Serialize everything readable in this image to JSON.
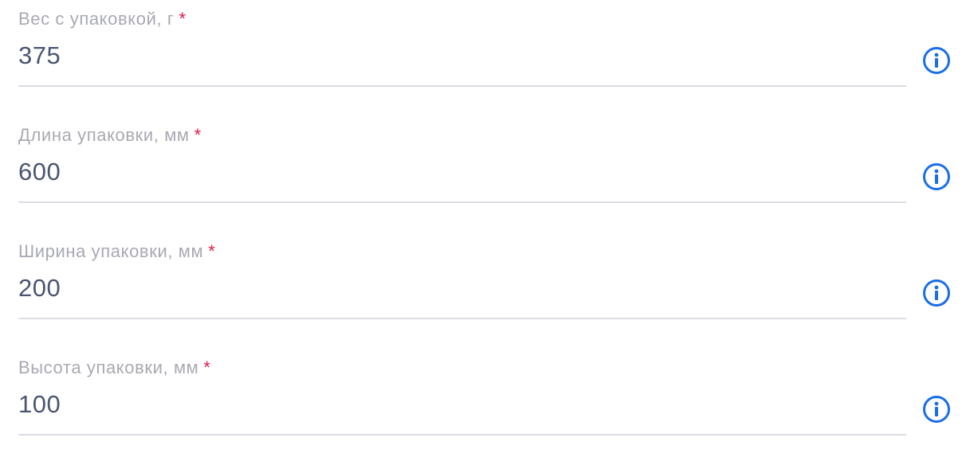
{
  "fields": [
    {
      "label": "Вес с упаковкой, г",
      "required_mark": "*",
      "value": "375",
      "icon": "info-icon"
    },
    {
      "label": "Длина упаковки, мм",
      "required_mark": "*",
      "value": "600",
      "icon": "info-icon"
    },
    {
      "label": "Ширина упаковки, мм",
      "required_mark": "*",
      "value": "200",
      "icon": "info-icon"
    },
    {
      "label": "Высота упаковки, мм",
      "required_mark": "*",
      "value": "100",
      "icon": "info-icon"
    }
  ],
  "colors": {
    "label": "#a8a9b3",
    "required": "#e0194a",
    "value": "#4a5573",
    "underline": "#dcdde6",
    "info_icon": "#1a6ee8"
  }
}
